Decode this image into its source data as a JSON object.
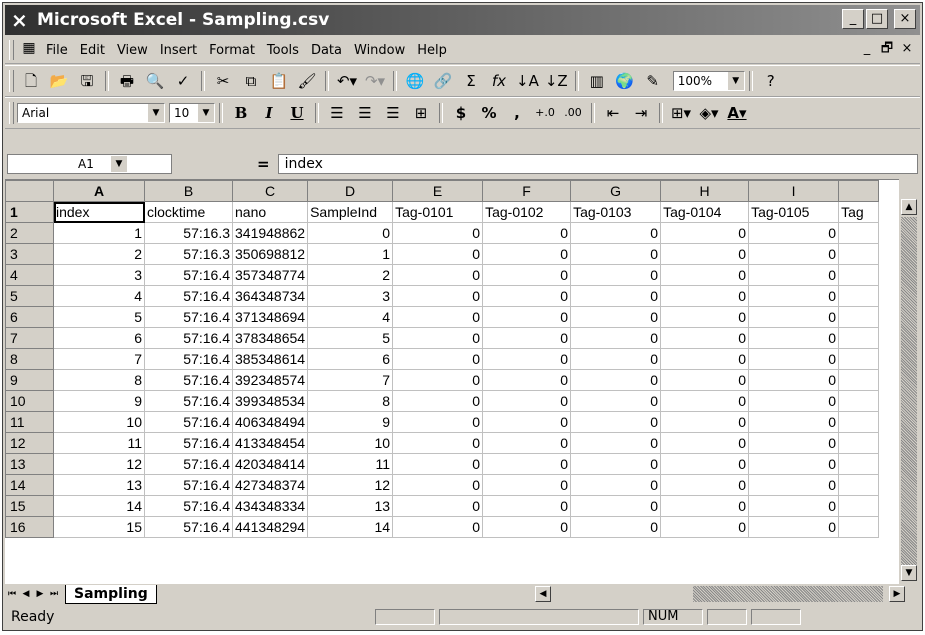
{
  "window": {
    "title": "Microsoft Excel - Sampling.csv",
    "buttons": {
      "minimize": "_",
      "maximize": "□",
      "close": "×"
    }
  },
  "menu": {
    "items": [
      "File",
      "Edit",
      "View",
      "Insert",
      "Format",
      "Tools",
      "Data",
      "Window",
      "Help"
    ],
    "doc_buttons": {
      "minimize": "_",
      "restore": "🗗",
      "close": "×"
    }
  },
  "toolbar_standard": {
    "zoom": "100%"
  },
  "toolbar_format": {
    "font": "Arial",
    "size": "10",
    "bold": "B",
    "italic": "I",
    "underline": "U",
    "currency": "$",
    "percent": "%",
    "comma": ","
  },
  "formula_bar": {
    "name_box": "A1",
    "equals": "=",
    "content": "index"
  },
  "columns": [
    "A",
    "B",
    "C",
    "D",
    "E",
    "F",
    "G",
    "H",
    "I",
    ""
  ],
  "rows": [
    {
      "num": "1",
      "cells": [
        "index",
        "clocktime",
        "nano",
        "SampleInd",
        "Tag-0101",
        "Tag-0102",
        "Tag-0103",
        "Tag-0104",
        "Tag-0105",
        "Tag"
      ]
    },
    {
      "num": "2",
      "cells": [
        "1",
        "57:16.3",
        "341948862",
        "0",
        "0",
        "0",
        "0",
        "0",
        "0",
        ""
      ]
    },
    {
      "num": "3",
      "cells": [
        "2",
        "57:16.3",
        "350698812",
        "1",
        "0",
        "0",
        "0",
        "0",
        "0",
        ""
      ]
    },
    {
      "num": "4",
      "cells": [
        "3",
        "57:16.4",
        "357348774",
        "2",
        "0",
        "0",
        "0",
        "0",
        "0",
        ""
      ]
    },
    {
      "num": "5",
      "cells": [
        "4",
        "57:16.4",
        "364348734",
        "3",
        "0",
        "0",
        "0",
        "0",
        "0",
        ""
      ]
    },
    {
      "num": "6",
      "cells": [
        "5",
        "57:16.4",
        "371348694",
        "4",
        "0",
        "0",
        "0",
        "0",
        "0",
        ""
      ]
    },
    {
      "num": "7",
      "cells": [
        "6",
        "57:16.4",
        "378348654",
        "5",
        "0",
        "0",
        "0",
        "0",
        "0",
        ""
      ]
    },
    {
      "num": "8",
      "cells": [
        "7",
        "57:16.4",
        "385348614",
        "6",
        "0",
        "0",
        "0",
        "0",
        "0",
        ""
      ]
    },
    {
      "num": "9",
      "cells": [
        "8",
        "57:16.4",
        "392348574",
        "7",
        "0",
        "0",
        "0",
        "0",
        "0",
        ""
      ]
    },
    {
      "num": "10",
      "cells": [
        "9",
        "57:16.4",
        "399348534",
        "8",
        "0",
        "0",
        "0",
        "0",
        "0",
        ""
      ]
    },
    {
      "num": "11",
      "cells": [
        "10",
        "57:16.4",
        "406348494",
        "9",
        "0",
        "0",
        "0",
        "0",
        "0",
        ""
      ]
    },
    {
      "num": "12",
      "cells": [
        "11",
        "57:16.4",
        "413348454",
        "10",
        "0",
        "0",
        "0",
        "0",
        "0",
        ""
      ]
    },
    {
      "num": "13",
      "cells": [
        "12",
        "57:16.4",
        "420348414",
        "11",
        "0",
        "0",
        "0",
        "0",
        "0",
        ""
      ]
    },
    {
      "num": "14",
      "cells": [
        "13",
        "57:16.4",
        "427348374",
        "12",
        "0",
        "0",
        "0",
        "0",
        "0",
        ""
      ]
    },
    {
      "num": "15",
      "cells": [
        "14",
        "57:16.4",
        "434348334",
        "13",
        "0",
        "0",
        "0",
        "0",
        "0",
        ""
      ]
    },
    {
      "num": "16",
      "cells": [
        "15",
        "57:16.4",
        "441348294",
        "14",
        "0",
        "0",
        "0",
        "0",
        "0",
        ""
      ]
    }
  ],
  "sheet_tabs": [
    "Sampling"
  ],
  "status": {
    "ready": "Ready",
    "num": "NUM"
  }
}
